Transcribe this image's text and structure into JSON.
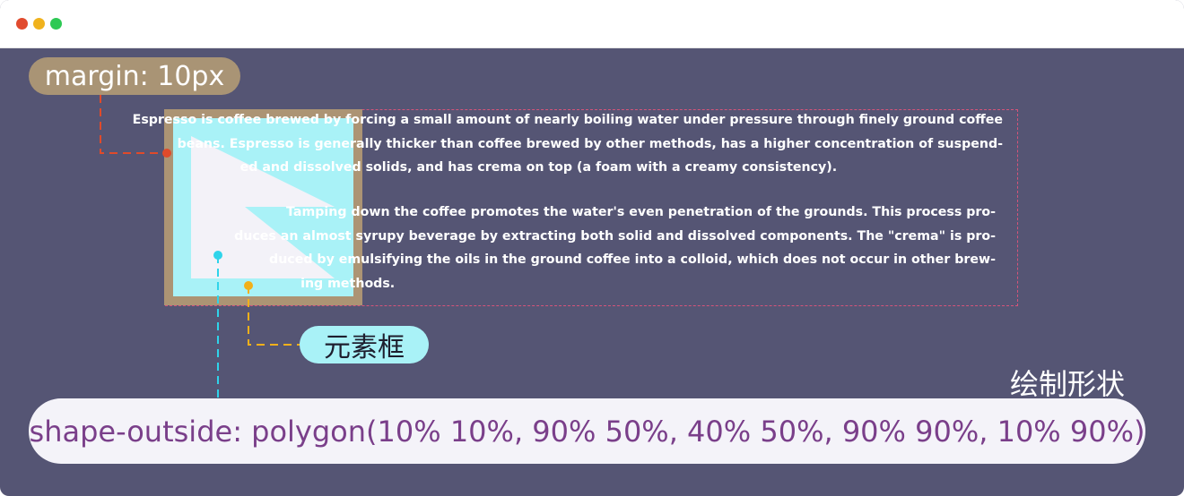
{
  "window": {
    "colors": {
      "background": "#555574",
      "titlebar": "#ffffff",
      "dot_red": "#e14b2e",
      "dot_yellow": "#f0b21d",
      "dot_green": "#2dc954"
    }
  },
  "labels": {
    "margin": "margin: 10px",
    "element_box": "元素框",
    "draw_shape": "绘制形状",
    "shape_outside": "shape-outside: polygon(10% 10%, 90% 50%, 40% 50%, 90% 90%, 10% 90%)"
  },
  "paragraphs": [
    {
      "lines": [
        "Espresso is coffee brewed by forcing a small amount of nearly boiling water under pressure through finely ground coffee",
        "beans. Espresso is generally thicker than coffee brewed by other methods, has a higher concentration of suspend-",
        "ed and dissolved solids, and has crema on top (a foam with a creamy consistency)."
      ]
    },
    {
      "lines": [
        "Tamping down the coffee promotes the water's even penetration of the grounds. This process pro-",
        "duces an almost syrupy beverage by extracting both solid and dissolved components. The \"crema\" is pro-",
        "duced by emulsifying the oils in the ground coffee into a colloid, which does not occur in other brew-",
        "ing methods."
      ]
    }
  ],
  "colors": {
    "margin_pill": "#a99475",
    "margin_box": "#ac9474",
    "element_box": "#a9f2f7",
    "shape_fill": "#f3f2f8",
    "code_text": "#7a3f8a",
    "margin_line": "#e04a2a",
    "box_line": "#f2b01a",
    "shape_line": "#2fd4ea",
    "text_area_border": "#d6547a"
  }
}
